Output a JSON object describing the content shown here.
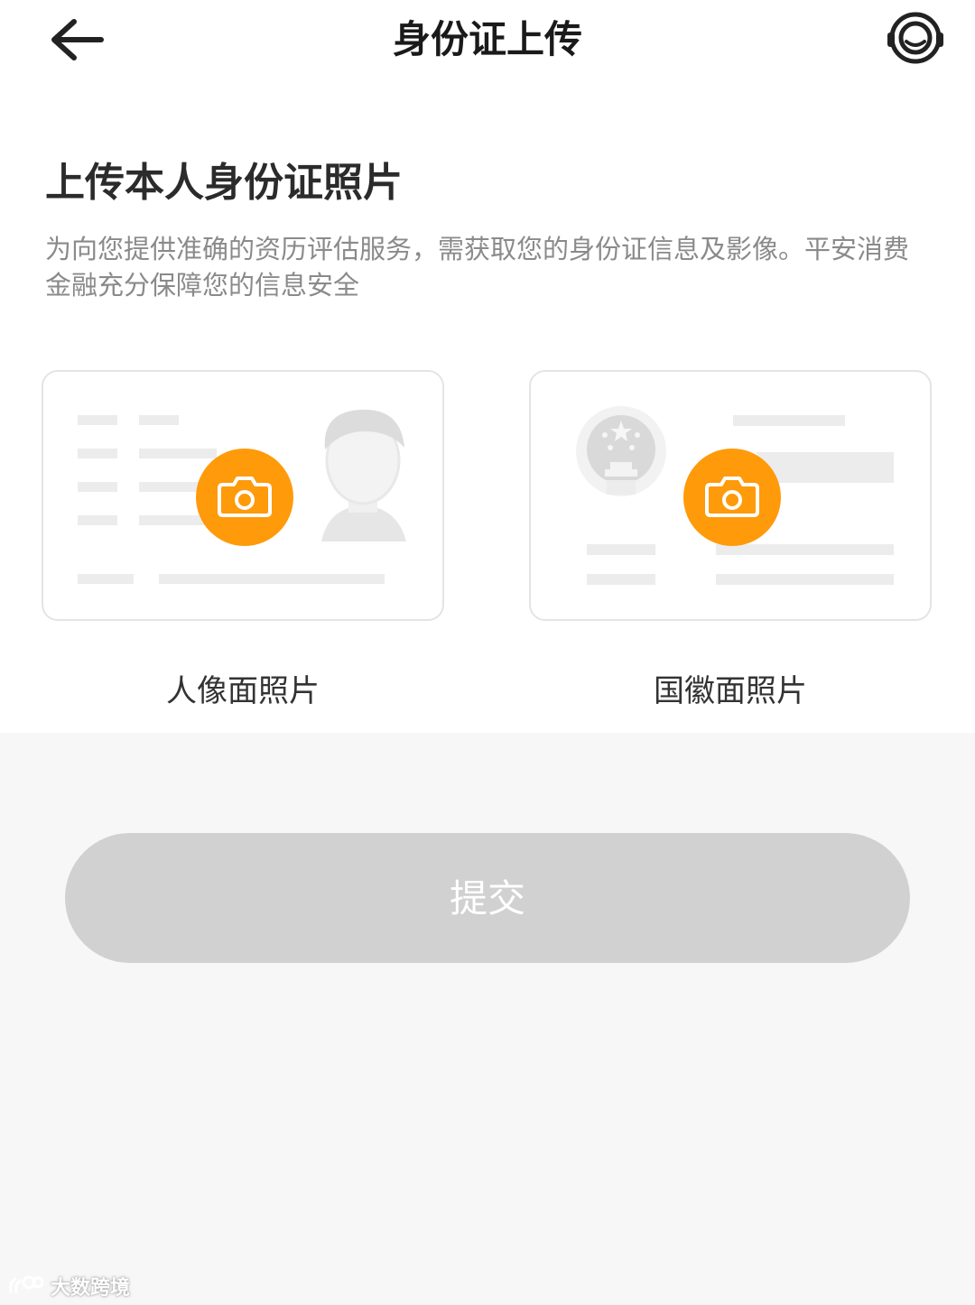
{
  "nav": {
    "title": "身份证上传",
    "back_icon": "arrow-left-icon",
    "service_icon": "customer-service-icon"
  },
  "content": {
    "heading": "上传本人身份证照片",
    "description": "为向您提供准确的资历评估服务，需获取您的身份证信息及影像。平安消费金融充分保障您的信息安全"
  },
  "cards": [
    {
      "label": "人像面照片",
      "icon": "camera-icon"
    },
    {
      "label": "国徽面照片",
      "icon": "camera-icon"
    }
  ],
  "submit": {
    "label": "提交"
  },
  "watermark": {
    "text": "大数跨境"
  },
  "colors": {
    "accent": "#ff9a0a",
    "button_disabled": "#d1d1d1",
    "page_bg": "#f7f7f7",
    "text_secondary": "#8a8a8a"
  }
}
